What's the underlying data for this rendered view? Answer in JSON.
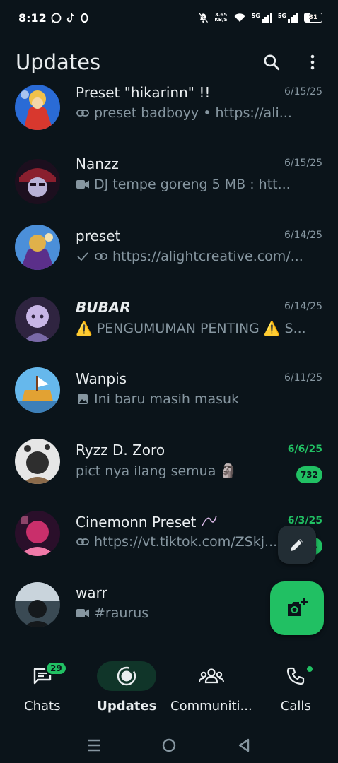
{
  "status_bar": {
    "time": "8:12",
    "left_icons": [
      "whatsapp-icon",
      "tiktok-icon",
      "circle-app-icon"
    ],
    "net_speed_value": "3.65",
    "net_speed_unit": "KB/S",
    "network_1": "5G",
    "network_2": "5G",
    "battery": "31"
  },
  "header": {
    "title": "Updates",
    "search_icon": "search-icon",
    "menu_icon": "more-vert-icon"
  },
  "rows": [
    {
      "name": "Preset \"hikarinn\" !!",
      "date": "6/15/25",
      "preview_icon": "link-icon",
      "preview": "preset badboyy  •  https://ali...",
      "date_green": false,
      "avatar_colors": [
        "#2a6bd6",
        "#d8382e",
        "#f1c14a"
      ]
    },
    {
      "name": "Nanzz",
      "date": "6/15/25",
      "preview_icon": "video-icon",
      "preview": "DJ tempe goreng   5 MB :  htt...",
      "date_green": false,
      "avatar_colors": [
        "#1c0f1e",
        "#8a1f2e",
        "#b9b2d6"
      ]
    },
    {
      "name": "preset",
      "date": "6/14/25",
      "preview_icon": "check-link-icon",
      "preview": "https://alightcreative.com/...",
      "date_green": false,
      "avatar_colors": [
        "#4b8fd9",
        "#5b2f8a",
        "#e0b14a"
      ]
    },
    {
      "name": "BUBAR",
      "date": "6/14/25",
      "preview_icon": "",
      "preview": "⚠️ PENGUMUMAN PENTING ⚠️  S...",
      "date_green": false,
      "italic": true,
      "avatar_colors": [
        "#2f2440",
        "#c8b6e6",
        "#7a6aa8"
      ]
    },
    {
      "name": "Wanpis",
      "date": "6/11/25",
      "preview_icon": "image-icon",
      "preview": "Ini baru masih masuk",
      "date_green": false,
      "avatar_colors": [
        "#66b8ec",
        "#e2a233",
        "#7a3f1c"
      ]
    },
    {
      "name": "Ryzz D. Zoro",
      "date": "6/6/25",
      "preview_icon": "",
      "preview": "pict nya ilang semua 🗿",
      "date_green": true,
      "unread": "732",
      "avatar_colors": [
        "#e6e6e6",
        "#2e2e2e",
        "#8a6a4a"
      ]
    },
    {
      "name": "Cinemonn Preset",
      "date": "6/3/25",
      "preview_icon": "link-icon",
      "preview": "https://vt.tiktok.com/ZSkj...",
      "date_green": true,
      "unread": "4",
      "avatar_colors": [
        "#c92f6b",
        "#2a0f2a",
        "#f07aa8"
      ]
    },
    {
      "name": "warr",
      "date": "",
      "preview_icon": "video-icon",
      "preview": "#raurus",
      "date_green": false,
      "avatar_colors": [
        "#3a4a54",
        "#c9d4dc",
        "#15191c"
      ]
    }
  ],
  "fab": {
    "edit_icon": "pencil-icon",
    "camera_icon": "camera-add-icon"
  },
  "bottom_nav": [
    {
      "label": "Chats",
      "icon": "chats-icon",
      "badge": "29",
      "active": false
    },
    {
      "label": "Updates",
      "icon": "updates-icon",
      "active": true
    },
    {
      "label": "Communiti...",
      "icon": "communities-icon",
      "active": false
    },
    {
      "label": "Calls",
      "icon": "calls-icon",
      "dot": true,
      "active": false
    }
  ],
  "system_nav": [
    "recents-icon",
    "home-icon",
    "back-icon"
  ],
  "colors": {
    "background": "#0b141a",
    "accent": "#21c063",
    "secondary_text": "#8696a0",
    "active_pill": "#103529"
  }
}
